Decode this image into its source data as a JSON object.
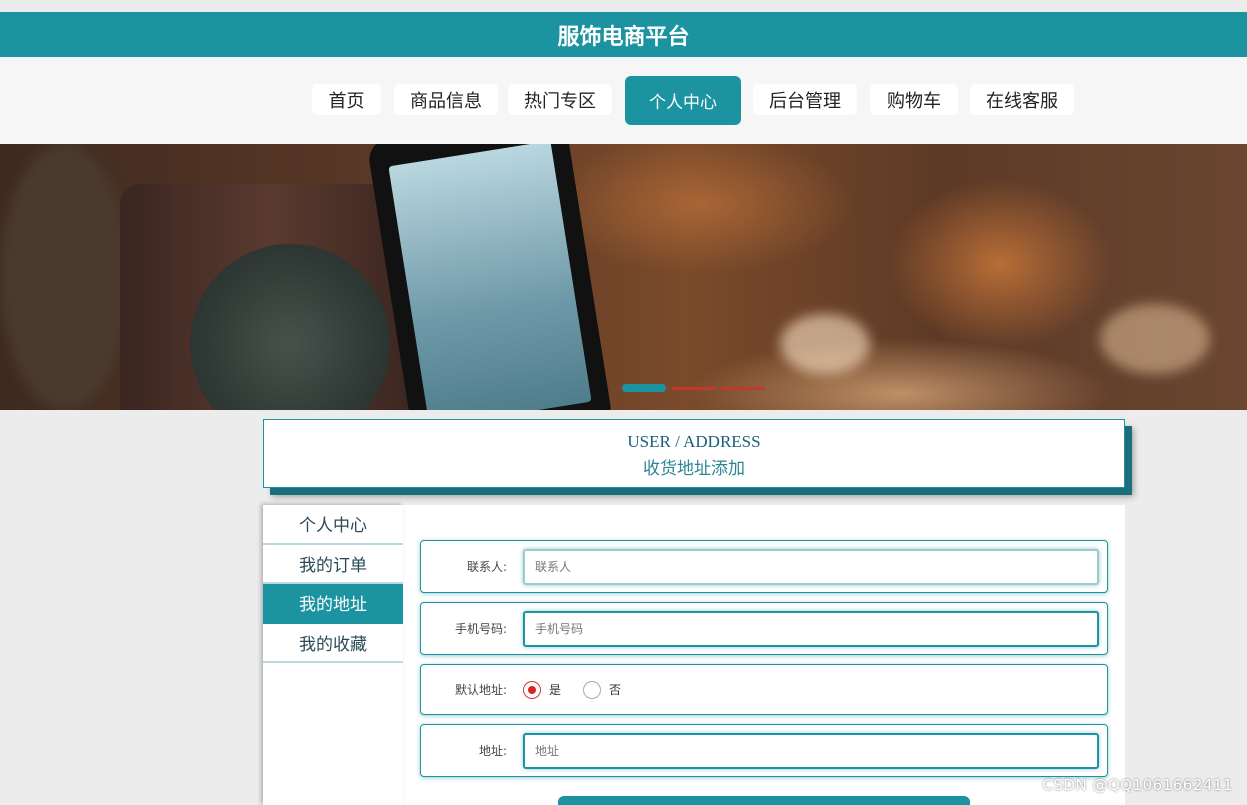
{
  "header": {
    "title": "服饰电商平台"
  },
  "nav": {
    "items": [
      {
        "label": "首页"
      },
      {
        "label": "商品信息"
      },
      {
        "label": "热门专区"
      },
      {
        "label": "个人中心"
      },
      {
        "label": "后台管理"
      },
      {
        "label": "购物车"
      },
      {
        "label": "在线客服"
      }
    ],
    "active": "个人中心"
  },
  "banner": {
    "slides": 3,
    "current_slide": 1
  },
  "section": {
    "heading_en": "USER / ADDRESS",
    "heading_cn": "收货地址添加"
  },
  "sidebar": {
    "items": [
      {
        "label": "个人中心"
      },
      {
        "label": "我的订单"
      },
      {
        "label": "我的地址"
      },
      {
        "label": "我的收藏"
      }
    ],
    "active": "我的地址"
  },
  "form": {
    "contact": {
      "label": "联系人:",
      "placeholder": "联系人"
    },
    "phone": {
      "label": "手机号码:",
      "placeholder": "手机号码"
    },
    "default_address": {
      "label": "默认地址:",
      "options": [
        "是",
        "否"
      ],
      "selected": "是"
    },
    "address": {
      "label": "地址:",
      "placeholder": "地址"
    }
  },
  "watermark": "CSDN @QQ1061662411",
  "colors": {
    "accent": "#1c93a1",
    "radio_checked": "#d22222",
    "banner_dot_inactive": "#c0392b"
  }
}
